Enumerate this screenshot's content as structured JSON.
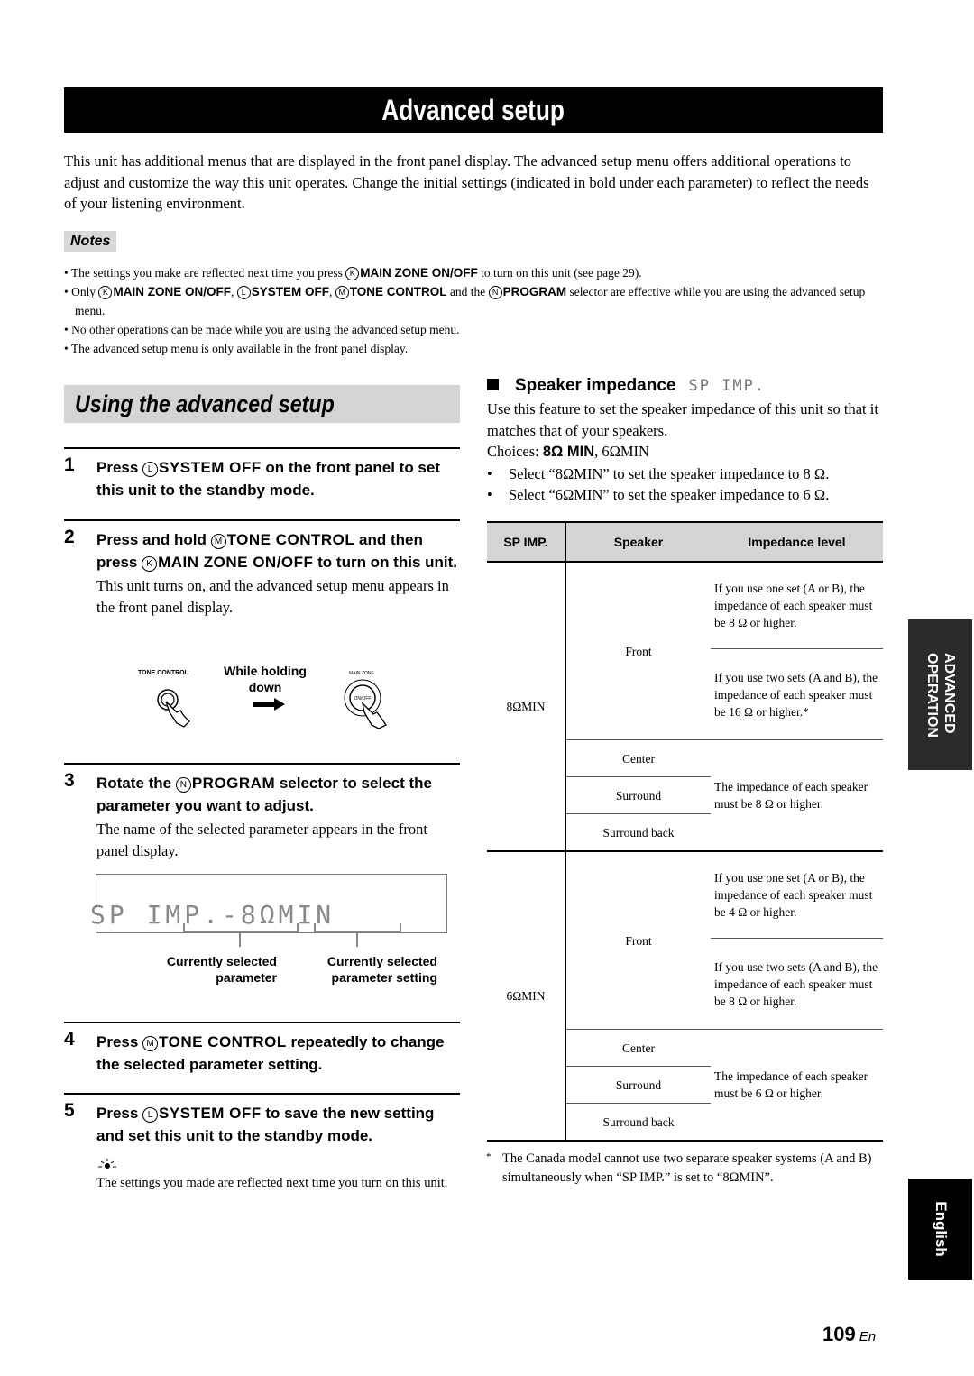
{
  "page": {
    "title": "Advanced setup",
    "intro": "This unit has additional menus that are displayed in the front panel display. The advanced setup menu offers additional operations to adjust and customize the way this unit operates. Change the initial settings (indicated in bold under each parameter) to reflect the needs of your listening environment.",
    "page_number": "109",
    "page_suffix": "En"
  },
  "notes": {
    "label": "Notes",
    "items": [
      {
        "pre": "The settings you make are reflected next time you press ",
        "key1_letter": "K",
        "key1": "MAIN ZONE ON/OFF",
        "post": " to turn on this unit (see page 29)."
      },
      {
        "pre": "Only ",
        "key1_letter": "K",
        "key1": "MAIN ZONE ON/OFF",
        "sep1": ", ",
        "key2_letter": "L",
        "key2": "SYSTEM OFF",
        "sep2": ", ",
        "key3_letter": "M",
        "key3": "TONE CONTROL",
        "sep3": " and the ",
        "key4_letter": "N",
        "key4": "PROGRAM",
        "post": " selector are effective while you are using the advanced setup menu."
      },
      {
        "text": "No other operations can be made while you are using the advanced setup menu."
      },
      {
        "text": "The advanced setup menu is only available in the front panel display."
      }
    ]
  },
  "using": {
    "heading": "Using the advanced setup",
    "steps": [
      {
        "num": "1",
        "pre": "Press ",
        "key_letter": "L",
        "key": "SYSTEM OFF",
        "post": " on the front panel to set this unit to the standby mode."
      },
      {
        "num": "2",
        "pre": "Press and hold ",
        "key_letter": "M",
        "key": "TONE CONTROL",
        "mid": " and then press ",
        "key2_letter": "K",
        "key2": "MAIN ZONE ON/OFF",
        "post": " to turn on this unit.",
        "body": "This unit turns on, and the advanced setup menu appears in the front panel display."
      },
      {
        "num": "3",
        "pre": "Rotate the ",
        "key_letter": "N",
        "key": "PROGRAM",
        "post": " selector to select the parameter you want to adjust.",
        "body": "The name of the selected parameter appears in the front panel display."
      },
      {
        "num": "4",
        "pre": "Press ",
        "key_letter": "M",
        "key": "TONE CONTROL",
        "post": " repeatedly to change the selected parameter setting."
      },
      {
        "num": "5",
        "pre": "Press ",
        "key_letter": "L",
        "key": "SYSTEM OFF",
        "post": " to save the new setting and set this unit to the standby mode."
      }
    ],
    "illustration": {
      "left_label": "TONE CONTROL",
      "middle_text_1": "While holding",
      "middle_text_2": "down",
      "right_label": "MAIN ZONE",
      "right_button": "ON/OFF"
    },
    "display": {
      "text": "SP IMP.-8ΩMIN",
      "callout_left_1": "Currently selected",
      "callout_left_2": "parameter",
      "callout_right_1": "Currently selected",
      "callout_right_2": "parameter setting"
    },
    "tip": "The settings you made are reflected next time you turn on this unit."
  },
  "speaker_impedance": {
    "heading": "Speaker impedance",
    "lcd": "SP IMP.",
    "desc": "Use this feature to set the speaker impedance of this unit so that it matches that of your speakers.",
    "choices_label": "Choices: ",
    "choice_default": "8Ω MIN",
    "choice_other": ", 6ΩMIN",
    "bullets": [
      "Select “8ΩMIN” to set the speaker impedance to 8 Ω.",
      "Select “6ΩMIN” to set the speaker impedance to 6 Ω."
    ],
    "table": {
      "headers": [
        "SP IMP.",
        "Speaker",
        "Impedance level"
      ],
      "groups": [
        {
          "setting": "8ΩMIN",
          "front": "Front",
          "front_one_set": "If you use one set (A or B), the impedance of each speaker must be 8 Ω or higher.",
          "front_two_sets": "If you use two sets (A and B), the impedance of each speaker must be 16 Ω or higher.*",
          "others": [
            "Center",
            "Surround",
            "Surround back"
          ],
          "others_level": "The impedance of each speaker must be 8 Ω or higher."
        },
        {
          "setting": "6ΩMIN",
          "front": "Front",
          "front_one_set": "If you use one set (A or B), the impedance of each speaker must be 4 Ω or higher.",
          "front_two_sets": "If you use two sets (A and B), the impedance of each speaker must be 8 Ω or higher.",
          "others": [
            "Center",
            "Surround",
            "Surround back"
          ],
          "others_level": "The impedance of each speaker must be 6 Ω or higher."
        }
      ]
    },
    "footnote_mark": "*",
    "footnote": "The Canada model cannot use two separate speaker systems (A and B) simultaneously when “SP IMP.” is set to “8ΩMIN”."
  },
  "side_tabs": {
    "section_line1": "ADVANCED",
    "section_line2": "OPERATION",
    "language": "English"
  }
}
